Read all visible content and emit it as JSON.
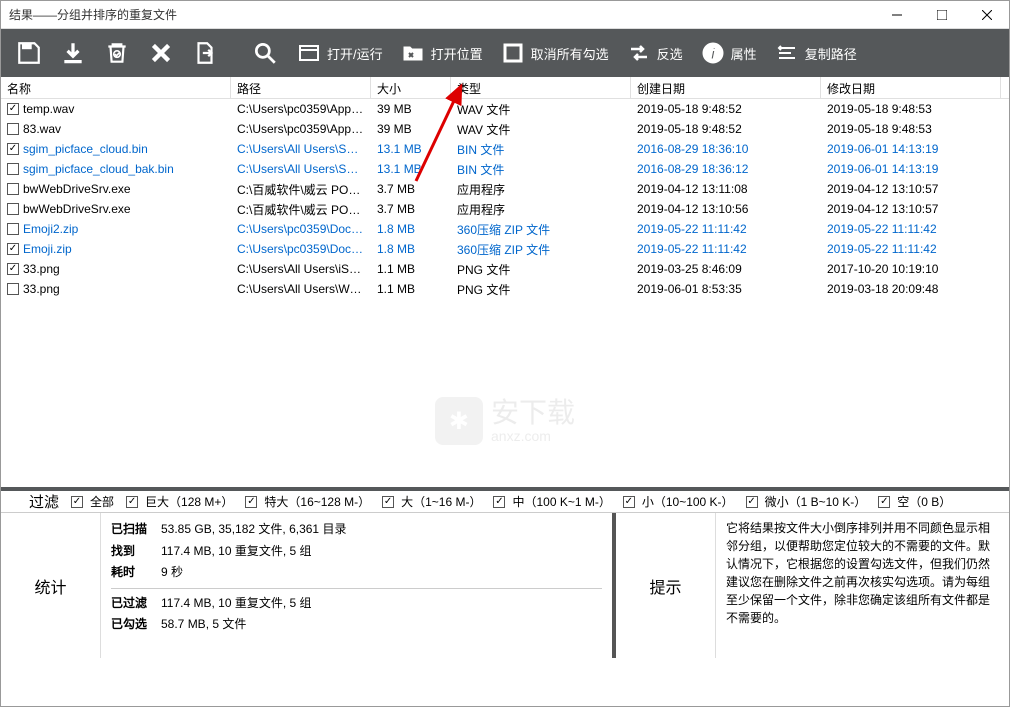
{
  "window": {
    "title": "结果——分组并排序的重复文件"
  },
  "toolbar": {
    "open_run": "打开/运行",
    "open_location": "打开位置",
    "deselect_all": "取消所有勾选",
    "invert": "反选",
    "properties": "属性",
    "copy_path": "复制路径"
  },
  "columns": {
    "name": "名称",
    "path": "路径",
    "size": "大小",
    "type": "类型",
    "created": "创建日期",
    "modified": "修改日期"
  },
  "rows": [
    {
      "checked": true,
      "blue": false,
      "name": "temp.wav",
      "path": "C:\\Users\\pc0359\\AppD...",
      "size": "39 MB",
      "type": "WAV 文件",
      "created": "2019-05-18 9:48:52",
      "modified": "2019-05-18 9:48:53"
    },
    {
      "checked": false,
      "blue": false,
      "name": "83.wav",
      "path": "C:\\Users\\pc0359\\AppD...",
      "size": "39 MB",
      "type": "WAV 文件",
      "created": "2019-05-18 9:48:52",
      "modified": "2019-05-18 9:48:53"
    },
    {
      "checked": true,
      "blue": true,
      "name": "sgim_picface_cloud.bin",
      "path": "C:\\Users\\All Users\\Sog...",
      "size": "13.1 MB",
      "type": "BIN 文件",
      "created": "2016-08-29 18:36:10",
      "modified": "2019-06-01 14:13:19"
    },
    {
      "checked": false,
      "blue": true,
      "name": "sgim_picface_cloud_bak.bin",
      "path": "C:\\Users\\All Users\\Sog...",
      "size": "13.1 MB",
      "type": "BIN 文件",
      "created": "2016-08-29 18:36:12",
      "modified": "2019-06-01 14:13:19"
    },
    {
      "checked": false,
      "blue": false,
      "name": "bwWebDriveSrv.exe",
      "path": "C:\\百威软件\\威云 POS...",
      "size": "3.7 MB",
      "type": "应用程序",
      "created": "2019-04-12 13:11:08",
      "modified": "2019-04-12 13:10:57"
    },
    {
      "checked": false,
      "blue": false,
      "name": "bwWebDriveSrv.exe",
      "path": "C:\\百威软件\\威云 POS...",
      "size": "3.7 MB",
      "type": "应用程序",
      "created": "2019-04-12 13:10:56",
      "modified": "2019-04-12 13:10:57"
    },
    {
      "checked": false,
      "blue": true,
      "name": "Emoji2.zip",
      "path": "C:\\Users\\pc0359\\Docu...",
      "size": "1.8 MB",
      "type": "360压缩 ZIP 文件",
      "created": "2019-05-22 11:11:42",
      "modified": "2019-05-22 11:11:42"
    },
    {
      "checked": true,
      "blue": true,
      "name": "Emoji.zip",
      "path": "C:\\Users\\pc0359\\Docu...",
      "size": "1.8 MB",
      "type": "360压缩 ZIP 文件",
      "created": "2019-05-22 11:11:42",
      "modified": "2019-05-22 11:11:42"
    },
    {
      "checked": true,
      "blue": false,
      "name": "33.png",
      "path": "C:\\Users\\All Users\\iSky...",
      "size": "1.1 MB",
      "type": "PNG 文件",
      "created": "2019-03-25 8:46:09",
      "modified": "2017-10-20 10:19:10"
    },
    {
      "checked": false,
      "blue": false,
      "name": "33.png",
      "path": "C:\\Users\\All Users\\Won...",
      "size": "1.1 MB",
      "type": "PNG 文件",
      "created": "2019-06-01 8:53:35",
      "modified": "2019-03-18 20:09:48"
    }
  ],
  "filter": {
    "label": "过滤",
    "all": "全部",
    "huge": "巨大（128 M+）",
    "xlarge": "特大（16~128 M-）",
    "large": "大（1~16 M-）",
    "medium": "中（100 K~1 M-）",
    "small": "小（10~100 K-）",
    "tiny": "微小（1 B~10 K-）",
    "empty": "空（0 B）"
  },
  "stats": {
    "title": "统计",
    "scanned_k": "已扫描",
    "scanned_v": "53.85 GB, 35,182 文件, 6,361 目录",
    "found_k": "找到",
    "found_v": "117.4 MB, 10 重复文件, 5 组",
    "elapsed_k": "耗时",
    "elapsed_v": "9 秒",
    "filtered_k": "已过滤",
    "filtered_v": "117.4 MB, 10 重复文件, 5 组",
    "checked_k": "已勾选",
    "checked_v": "58.7 MB, 5 文件"
  },
  "tip": {
    "title": "提示",
    "body": "它将结果按文件大小倒序排列并用不同颜色显示相邻分组，以便帮助您定位较大的不需要的文件。默认情况下，它根据您的设置勾选文件，但我们仍然建议您在删除文件之前再次核实勾选项。请为每组至少保留一个文件，除非您确定该组所有文件都是不需要的。"
  },
  "watermark": {
    "label": "安下载",
    "url": "anxz.com"
  }
}
